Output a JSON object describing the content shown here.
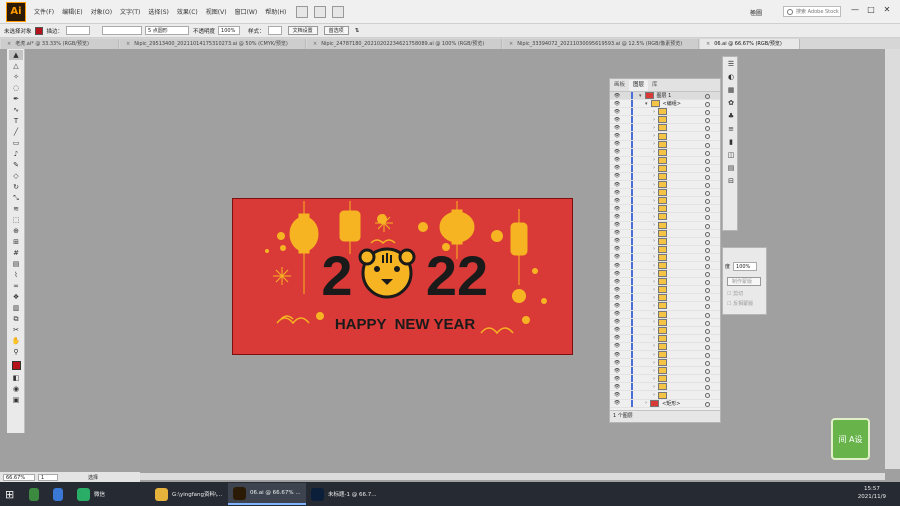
{
  "app": {
    "logo": "Ai",
    "workspace": "極圖",
    "stock_search_placeholder": "搜索 Adobe Stock"
  },
  "menu": [
    "文件(F)",
    "编辑(E)",
    "对象(O)",
    "文字(T)",
    "选择(S)",
    "效果(C)",
    "视图(V)",
    "窗口(W)",
    "帮助(H)"
  ],
  "control": {
    "selection": "未选择对象",
    "fill_color": "#b5121b",
    "stroke_label": "描边：",
    "brush": "5 点圆形",
    "opacity_label": "不透明度",
    "opacity": "100%",
    "style_label": "样式：",
    "doc_setup": "文档设置",
    "prefs": "首选项"
  },
  "tabs": [
    {
      "label": "老虎.ai* @ 33.33% (RGB/预览)",
      "active": false
    },
    {
      "label": "Nipic_29513400_20211014175310273.ai @ 50% (CMYK/预览)",
      "active": false
    },
    {
      "label": "Nipic_24787180_20210202234621758089.ai @ 100% (RGB/预览)",
      "active": false
    },
    {
      "label": "Nipic_33394072_20211030095619593.ai @ 12.5% (RGB/像素预览)",
      "active": false
    },
    {
      "label": "06.ai @ 66.67% (RGB/预览)",
      "active": true
    }
  ],
  "artwork": {
    "digits_left": "2",
    "digits_right": "22",
    "greeting": "HAPPY  NEW YEAR",
    "bg_color": "#d93a37",
    "gold": "#f6b422",
    "dark": "#1a1a1a"
  },
  "layers_panel": {
    "tabs": [
      "画板",
      "图层",
      "库"
    ],
    "active_tab": "图层",
    "top_layer": "图层 1",
    "group": "<编组>",
    "sublayer_count": 36,
    "rect_layer": "<矩形>",
    "footer": "1 个图层"
  },
  "transparency": {
    "label": "度",
    "opacity": "100%",
    "btn": "制作蒙版",
    "clip": "剪切",
    "invert": "反相蒙版"
  },
  "status": {
    "zoom": "66.67%",
    "artboard": "1",
    "tool": "选择"
  },
  "taskbar": {
    "apps": [
      {
        "label": "",
        "icon": "chrome-icon",
        "color": "#3c8a3f"
      },
      {
        "label": "",
        "icon": "wps-icon",
        "color": "#3a78d6"
      },
      {
        "label": "微信",
        "icon": "wechat-icon",
        "color": "#2aae67"
      },
      {
        "label": "G:\\yingfang资料\\...",
        "icon": "folder-icon",
        "color": "#e5b33b"
      },
      {
        "label": "06.ai @ 66.67% ...",
        "icon": "illustrator-icon",
        "color": "#2b1a05"
      },
      {
        "label": "未标题-1 @ 66.7...",
        "icon": "photoshop-icon",
        "color": "#0b1f3a"
      }
    ],
    "time": "15:57",
    "date": "2021/11/9"
  },
  "watermark": "间 A设"
}
